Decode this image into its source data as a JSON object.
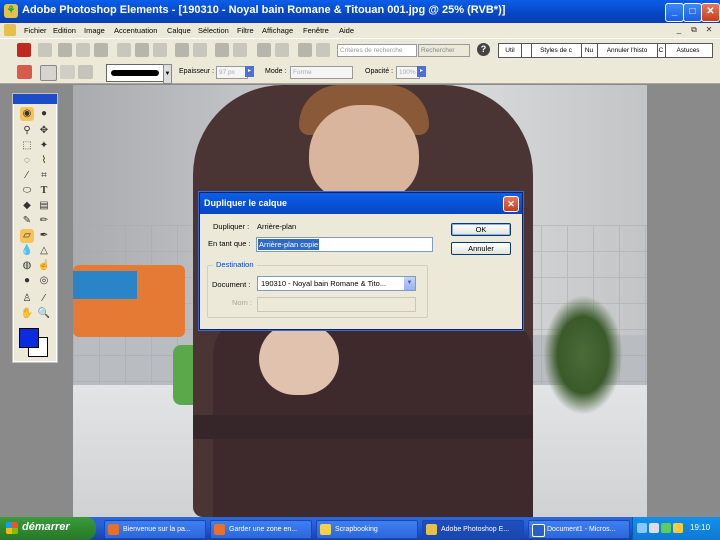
{
  "window": {
    "title": "Adobe Photoshop Elements - [190310 - Noyal bain Romane & Titouan 001.jpg @ 25% (RVB*)]",
    "minimize": "_",
    "maximize": "□",
    "close": "✕"
  },
  "menu": {
    "items": [
      "Fichier",
      "Edition",
      "Image",
      "Accentuation",
      "Calque",
      "Sélection",
      "Filtre",
      "Affichage",
      "Fenêtre",
      "Aide"
    ],
    "right_buttons": [
      "_",
      "⧉",
      "✕"
    ]
  },
  "shortcuts": {
    "search_placeholder": "Critères de recherche",
    "search_button": "Rechercher",
    "palette_tabs": [
      "Util",
      "",
      "Styles de c",
      "Nu",
      "Annuler l'histo",
      "C",
      "Astuces"
    ]
  },
  "options": {
    "epaisseur_label": "Epaisseur :",
    "epaisseur_value": "97 px",
    "mode_label": "Mode :",
    "mode_value": "Forme",
    "opacite_label": "Opacité :",
    "opacite_value": "100%"
  },
  "dialog": {
    "title": "Dupliquer le calque",
    "dupliquer_label": "Dupliquer :",
    "dupliquer_value": "Arrière-plan",
    "en_tant_que_label": "En tant que :",
    "en_tant_que_value": "Arrière-plan copie",
    "ok_label": "OK",
    "cancel_label": "Annuler",
    "destination_label": "Destination",
    "document_label": "Document :",
    "document_value": "190310 - Noyal bain Romane & Tito...",
    "nom_label": "Nom :",
    "close": "✕"
  },
  "taskbar": {
    "start_label": "démarrer",
    "tasks": [
      "Bienvenue sur la pa...",
      "Garder une zone en...",
      "Scrapbooking",
      "Adobe Photoshop E...",
      "Document1 - Micros..."
    ],
    "clock": "19:10"
  },
  "colors": {
    "foreground": "#0a2be0",
    "background": "#ffffff",
    "title_bar": "#0746c4",
    "taskbar": "#245edb"
  }
}
